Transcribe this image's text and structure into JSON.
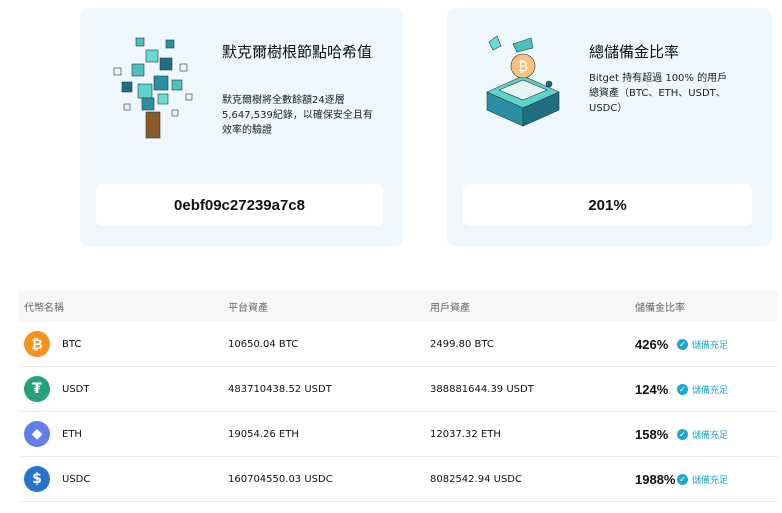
{
  "cards": {
    "merkle": {
      "title": "默克爾樹根節點哈希值",
      "description": "默克爾樹將全數餘額24逐層5,647,539紀錄，以確保安全且有效率的驗證",
      "value": "0ebf09c27239a7c8"
    },
    "reserve": {
      "title": "總儲備金比率",
      "description": "Bitget 持有超過 100% 的用戶總資產（BTC、ETH、USDT、USDC）",
      "value": "201%"
    }
  },
  "table": {
    "headers": [
      "代幣名稱",
      "平台資產",
      "用戶資產",
      "儲備金比率"
    ],
    "rows": [
      {
        "coin": "BTC",
        "icon": "bitcoin-icon",
        "color": "#f7931a",
        "glyph": "₿",
        "platform": "10650.04 BTC",
        "user": "2499.80 BTC",
        "ratio": "426%",
        "status": "儲備充足"
      },
      {
        "coin": "USDT",
        "icon": "tether-icon",
        "color": "#26a17b",
        "glyph": "₮",
        "platform": "483710438.52 USDT",
        "user": "388881644.39 USDT",
        "ratio": "124%",
        "status": "儲備充足"
      },
      {
        "coin": "ETH",
        "icon": "ethereum-icon",
        "color": "#627eea",
        "glyph": "◆",
        "platform": "19054.26 ETH",
        "user": "12037.32 ETH",
        "ratio": "158%",
        "status": "儲備充足"
      },
      {
        "coin": "USDC",
        "icon": "usdc-icon",
        "color": "#2775ca",
        "glyph": "$",
        "platform": "160704550.03 USDC",
        "user": "8082542.94 USDC",
        "ratio": "1988%",
        "status": "儲備充足"
      }
    ]
  }
}
